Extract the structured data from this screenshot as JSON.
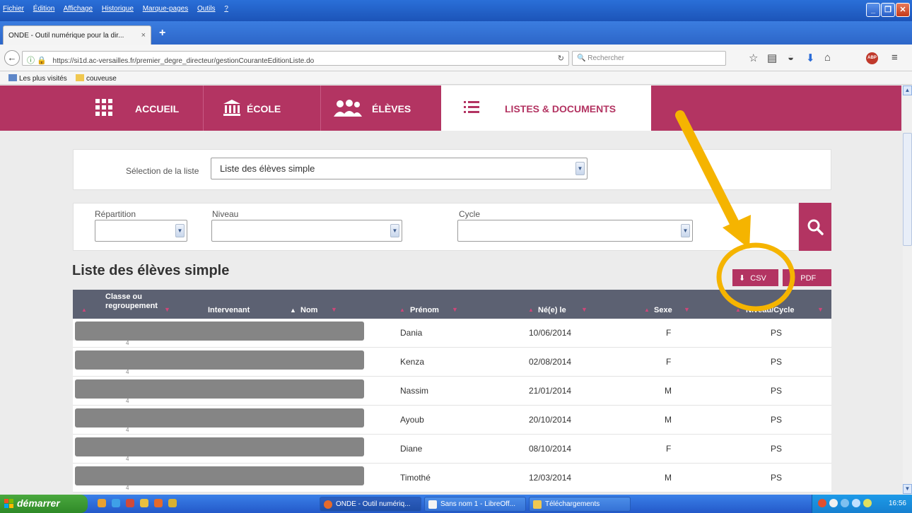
{
  "browser": {
    "menu": [
      "Fichier",
      "Édition",
      "Affichage",
      "Historique",
      "Marque-pages",
      "Outils",
      "?"
    ],
    "tab_title": "ONDE - Outil numérique pour la dir...",
    "tab_close": "×",
    "new_tab": "+",
    "url": "https://si1d.ac-versailles.fr/premier_degre_directeur/gestionCouranteEditionListe.do",
    "search_placeholder": "Rechercher",
    "bookmarks": [
      "Les plus visités",
      "couveuse"
    ],
    "abp_label": "ABP"
  },
  "site_nav": {
    "items": [
      "ACCUEIL",
      "ÉCOLE",
      "ÉLÈVES",
      "LISTES & DOCUMENTS"
    ],
    "active_index": 3,
    "colors": {
      "brand": "#b33462",
      "header_bg": "#5c6172"
    }
  },
  "list_select": {
    "label": "Sélection de la liste",
    "value": "Liste des élèves simple"
  },
  "filters": [
    {
      "label": "Répartition",
      "value": ""
    },
    {
      "label": "Niveau",
      "value": ""
    },
    {
      "label": "Cycle",
      "value": ""
    }
  ],
  "page_title": "Liste des élèves simple",
  "export": {
    "csv": "CSV",
    "pdf": "PDF"
  },
  "table": {
    "columns": [
      "Classe ou regroupement",
      "Intervenant",
      "Nom",
      "Prénom",
      "Né(e) le",
      "Sexe",
      "Niveau/Cycle"
    ],
    "rows": [
      {
        "prenom": "Dania",
        "naissance": "10/06/2014",
        "sexe": "F",
        "niveau": "PS",
        "classe_fragment": "4"
      },
      {
        "prenom": "Kenza",
        "naissance": "02/08/2014",
        "sexe": "F",
        "niveau": "PS",
        "classe_fragment": "4"
      },
      {
        "prenom": "Nassim",
        "naissance": "21/01/2014",
        "sexe": "M",
        "niveau": "PS",
        "classe_fragment": "4"
      },
      {
        "prenom": "Ayoub",
        "naissance": "20/10/2014",
        "sexe": "M",
        "niveau": "PS",
        "classe_fragment": "4"
      },
      {
        "prenom": "Diane",
        "naissance": "08/10/2014",
        "sexe": "F",
        "niveau": "PS",
        "classe_fragment": "4"
      },
      {
        "prenom": "Timothé",
        "naissance": "12/03/2014",
        "sexe": "M",
        "niveau": "PS",
        "classe_fragment": "4"
      }
    ]
  },
  "taskbar": {
    "start": "démarrer",
    "tasks": [
      "ONDE - Outil numériq...",
      "Sans nom 1 - LibreOff...",
      "Téléchargements"
    ],
    "clock": "16:56"
  },
  "annotation": {
    "color": "#f5b400"
  }
}
